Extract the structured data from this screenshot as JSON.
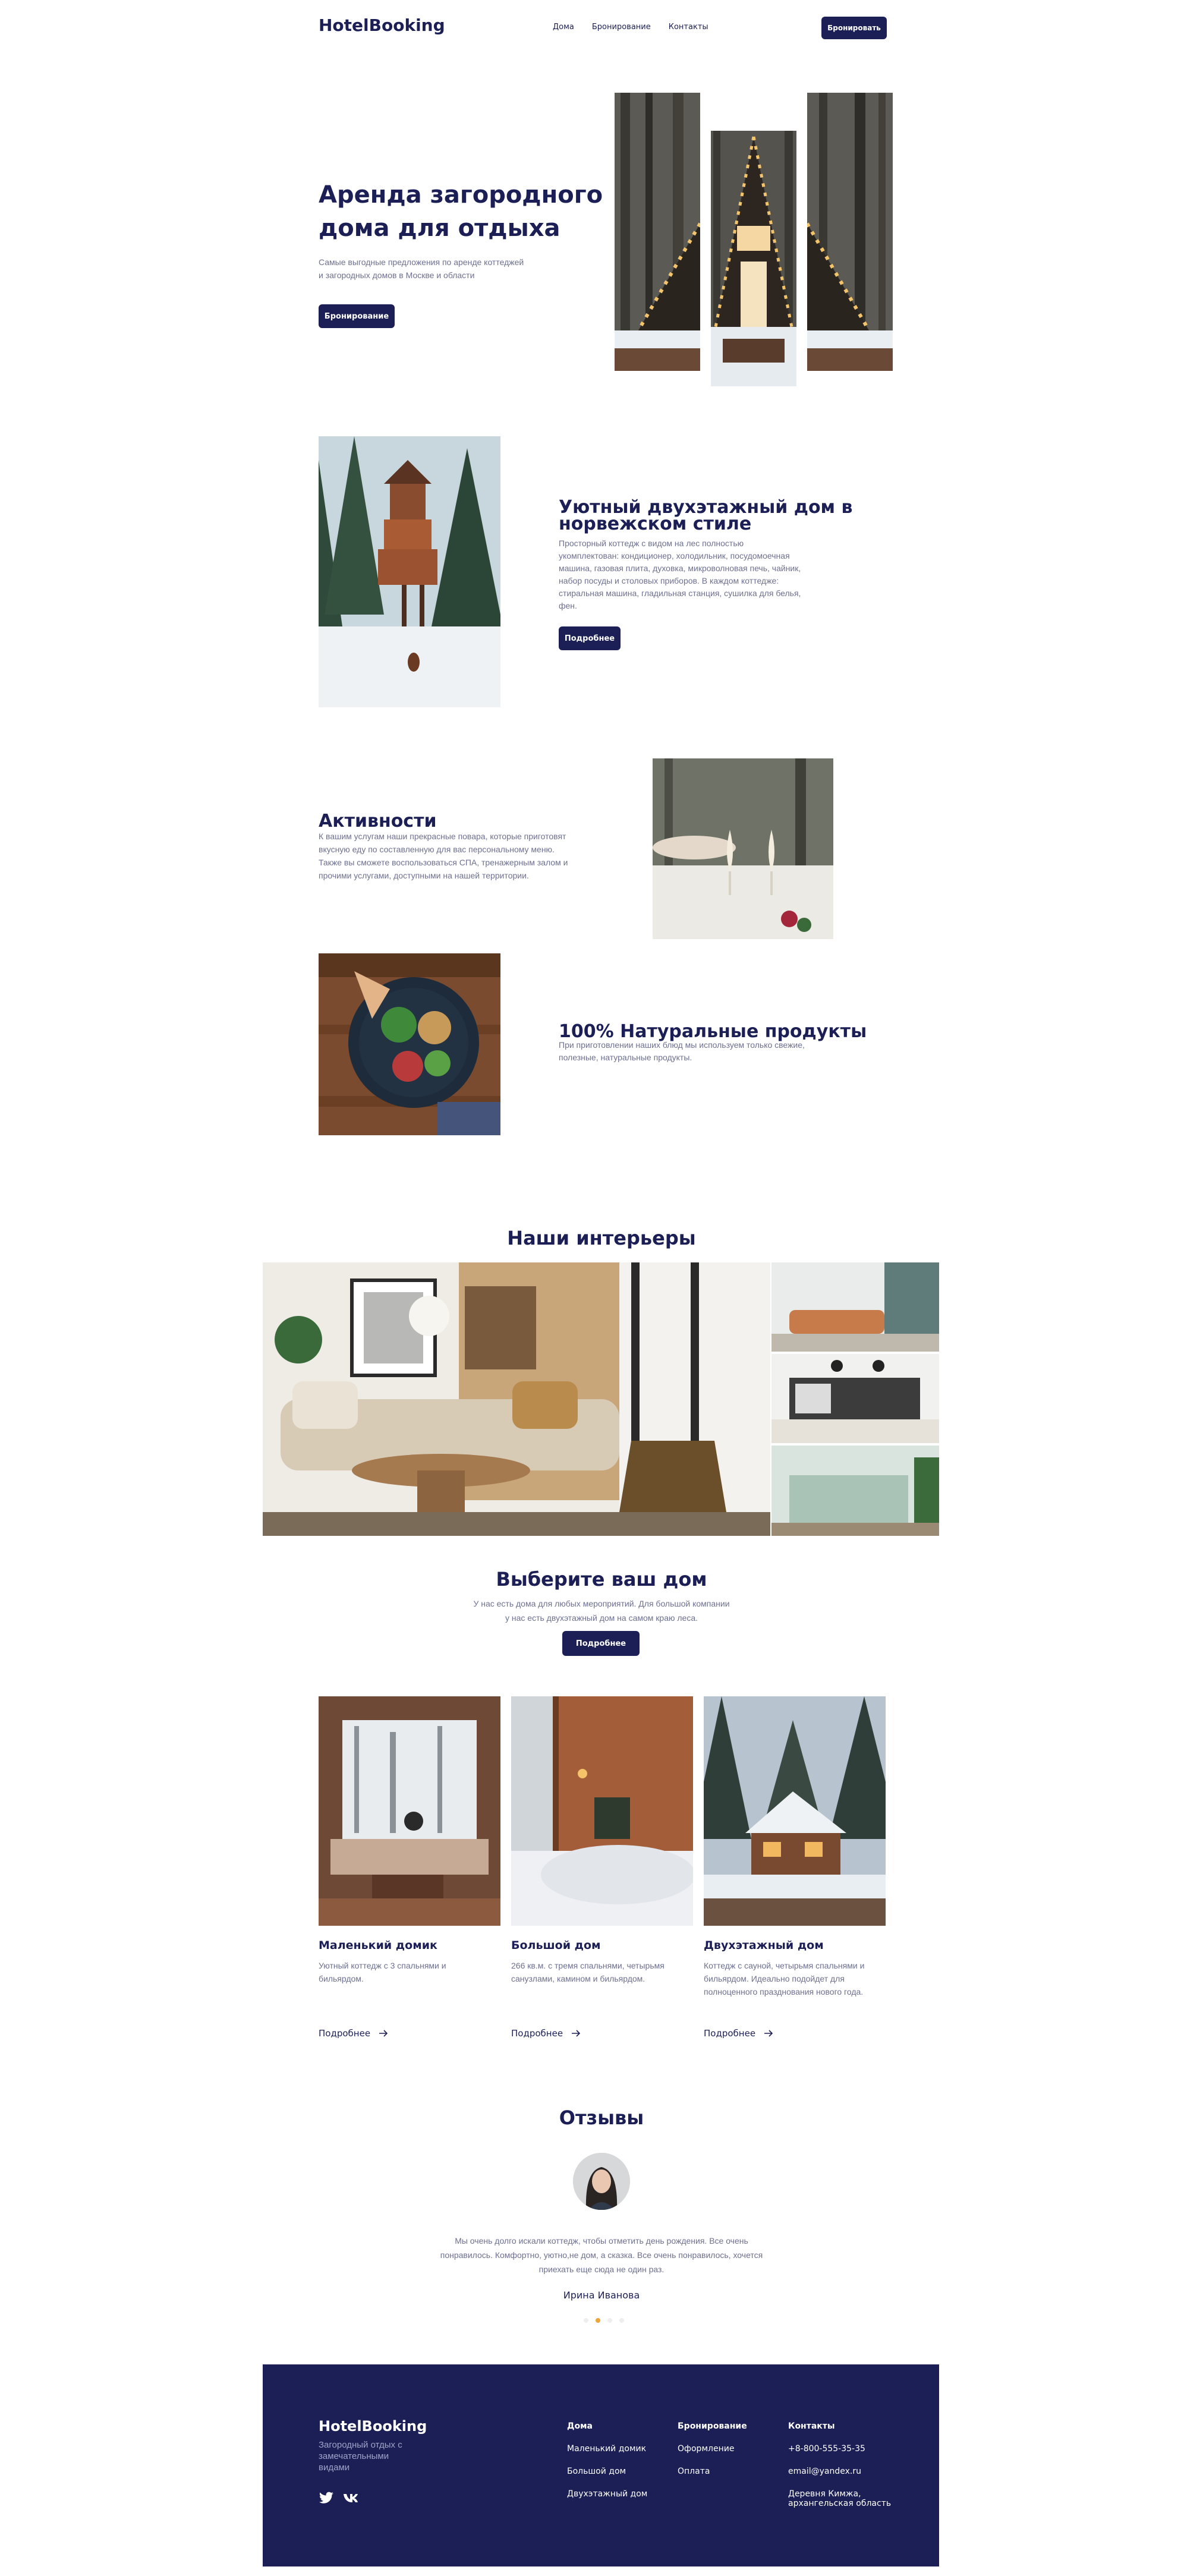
{
  "header": {
    "logo": "HotelBooking",
    "nav": [
      "Дома",
      "Бронирование",
      "Контакты"
    ],
    "cta": "Бронировать"
  },
  "hero": {
    "title_line1": "Аренда загородного",
    "title_line2": "дома для отдыха",
    "text_line1": "Самые выгодные предложения по аренде коттеджей",
    "text_line2": "и загородных домов в Москве и области",
    "button": "Бронирование"
  },
  "house": {
    "title_line1": "Уютный двухэтажный дом в",
    "title_line2": "норвежском стиле",
    "text": [
      "Просторный коттедж с видом на лес полностью",
      "укомплектован: кондиционер, холодильник, посудомоечная",
      "машина, газовая плита, духовка, микроволновая печь, чайник,",
      "набор посуды и столовых приборов. В каждом коттедже:",
      "стиральная машина, гладильная станция, сушилка для белья,",
      "фен."
    ],
    "button": "Подробнее"
  },
  "activities": {
    "title": "Активности",
    "text": [
      "К вашим услугам наши прекрасные повара, которые приготовят",
      "вкусную еду по составленную для вас персональному меню.",
      "Также вы сможете воспользоваться СПА, тренажерным залом и",
      "прочими услугами, доступными на нашей территории."
    ]
  },
  "products": {
    "title": "100% Натуральные продукты",
    "text": [
      "При приготовлении наших блюд мы используем только свежие,",
      "полезные, натуральные продукты."
    ]
  },
  "interiors": {
    "title": "Наши интерьеры"
  },
  "choose": {
    "title": "Выберите ваш дом",
    "text_line1": "У нас есть дома для любых мероприятий. Для большой компании",
    "text_line2": "у нас есть двухэтажный дом на самом краю леса.",
    "button": "Подробнее"
  },
  "cards": [
    {
      "title": "Маленький домик",
      "text": [
        "Уютный коттедж с 3 спальнями и",
        "бильярдом."
      ],
      "link": "Подробнее"
    },
    {
      "title": "Большой дом",
      "text": [
        "266 кв.м. с тремя спальнями, четырьмя",
        "санузлами, камином и бильярдом."
      ],
      "link": "Подробнее"
    },
    {
      "title": "Двухэтажный дом",
      "text": [
        "Коттедж с сауной, четырьмя спальнями и",
        "бильярдом. Идеально подойдет для",
        "полноценного празднования нового года."
      ],
      "link": "Подробнее"
    }
  ],
  "reviews": {
    "title": "Отзывы",
    "text": [
      "Мы очень долго искали коттедж, чтобы отметить день рождения. Все очень",
      "понравилось. Комфортно, уютно,не дом, а сказка. Все очень понравилось, хочется",
      "приехать еще сюда не один раз."
    ],
    "author": "Ирина Иванова",
    "active_dot": 1
  },
  "footer": {
    "logo": "HotelBooking",
    "tagline": [
      "Загородный отдых с",
      "замечательными",
      "видами"
    ],
    "col1_title": "Дома",
    "col1": [
      "Маленький домик",
      "Большой дом",
      "Двухэтажный дом"
    ],
    "col2_title": "Бронирование",
    "col2": [
      "Оформление",
      "Оплата"
    ],
    "col3_title": "Контакты",
    "phone": "+8-800-555-35-35",
    "email": "email@yandex.ru",
    "address_line1": "Деревня Кимжа,",
    "address_line2": "архангельская область"
  },
  "colors": {
    "navy": "#1b1f55",
    "accent_dot": "#f2a23a",
    "muted": "#6d7090"
  },
  "icons": [
    "twitter-icon",
    "vk-icon",
    "arrow-right-icon"
  ]
}
